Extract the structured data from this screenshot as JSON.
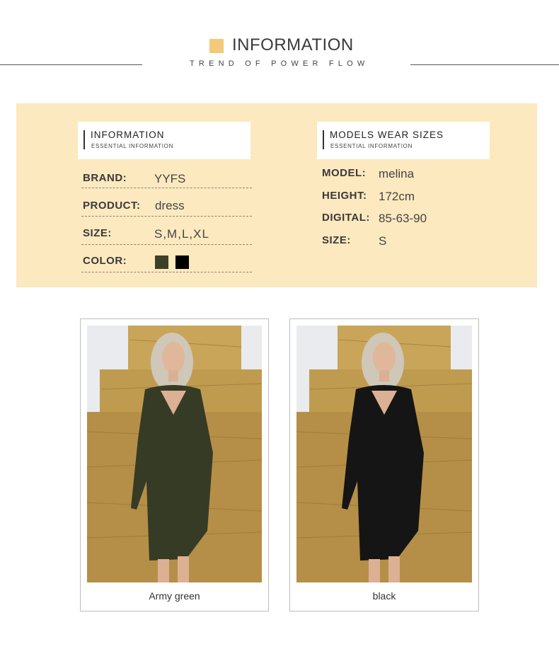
{
  "header": {
    "title": "INFORMATION",
    "subtitle": "TREND OF POWER FLOW"
  },
  "left_card": {
    "title": "INFORMATION",
    "subtitle": "ESSENTIAL INFORMATION"
  },
  "right_card": {
    "title": "MODELS WEAR SIZES",
    "subtitle": "ESSENTIAL INFORMATION"
  },
  "product_info": {
    "brand_label": "BRAND:",
    "brand_value": "YYFS",
    "product_label": "PRODUCT:",
    "product_value": "dress",
    "size_label": "SIZE:",
    "size_value": "S,M,L,XL",
    "color_label": "COLOR:",
    "swatches": [
      "#3b4128",
      "#000000"
    ]
  },
  "model_info": {
    "model_label": "MODEL:",
    "model_value": "melina",
    "height_label": "HEIGHT:",
    "height_value": "172cm",
    "digital_label": "DIGITAL:",
    "digital_value": "85-63-90",
    "size_label": "SIZE:",
    "size_value": "S"
  },
  "photos": [
    {
      "caption": "Army green",
      "dress_color": "#363b26"
    },
    {
      "caption": "black",
      "dress_color": "#151515"
    }
  ],
  "colors": {
    "accent": "#f2ca7a",
    "panel": "#fde9bf",
    "hay": "#c7a45b",
    "sky": "#e9ebee"
  }
}
